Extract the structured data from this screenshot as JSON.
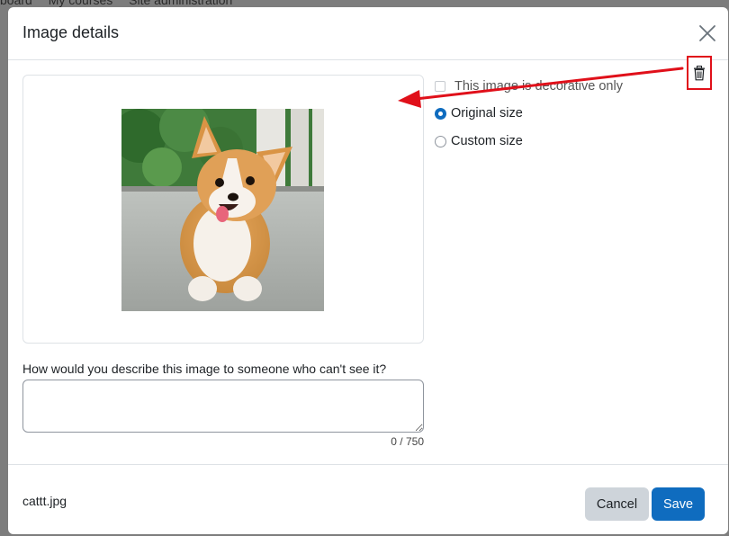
{
  "background_nav": {
    "items": [
      "board",
      "My courses",
      "Site administration"
    ]
  },
  "modal": {
    "title": "Image details",
    "close_icon": "close-icon"
  },
  "image": {
    "description": "corgi puppy photo",
    "icon": "image-preview"
  },
  "options": {
    "decorative_label": "This image is decorative only",
    "decorative_checked": false,
    "original_size_label": "Original size",
    "custom_size_label": "Custom size",
    "selected_size": "original"
  },
  "delete": {
    "icon": "trash-icon",
    "highlight_color": "#e0101a"
  },
  "alt_text": {
    "label": "How would you describe this image to someone who can't see it?",
    "value": "",
    "char_count": "0 / 750"
  },
  "footer": {
    "filename": "cattt.jpg",
    "cancel_label": "Cancel",
    "save_label": "Save"
  },
  "colors": {
    "primary": "#0f6cbf",
    "secondary": "#ced4da",
    "annotation": "#e0101a"
  }
}
